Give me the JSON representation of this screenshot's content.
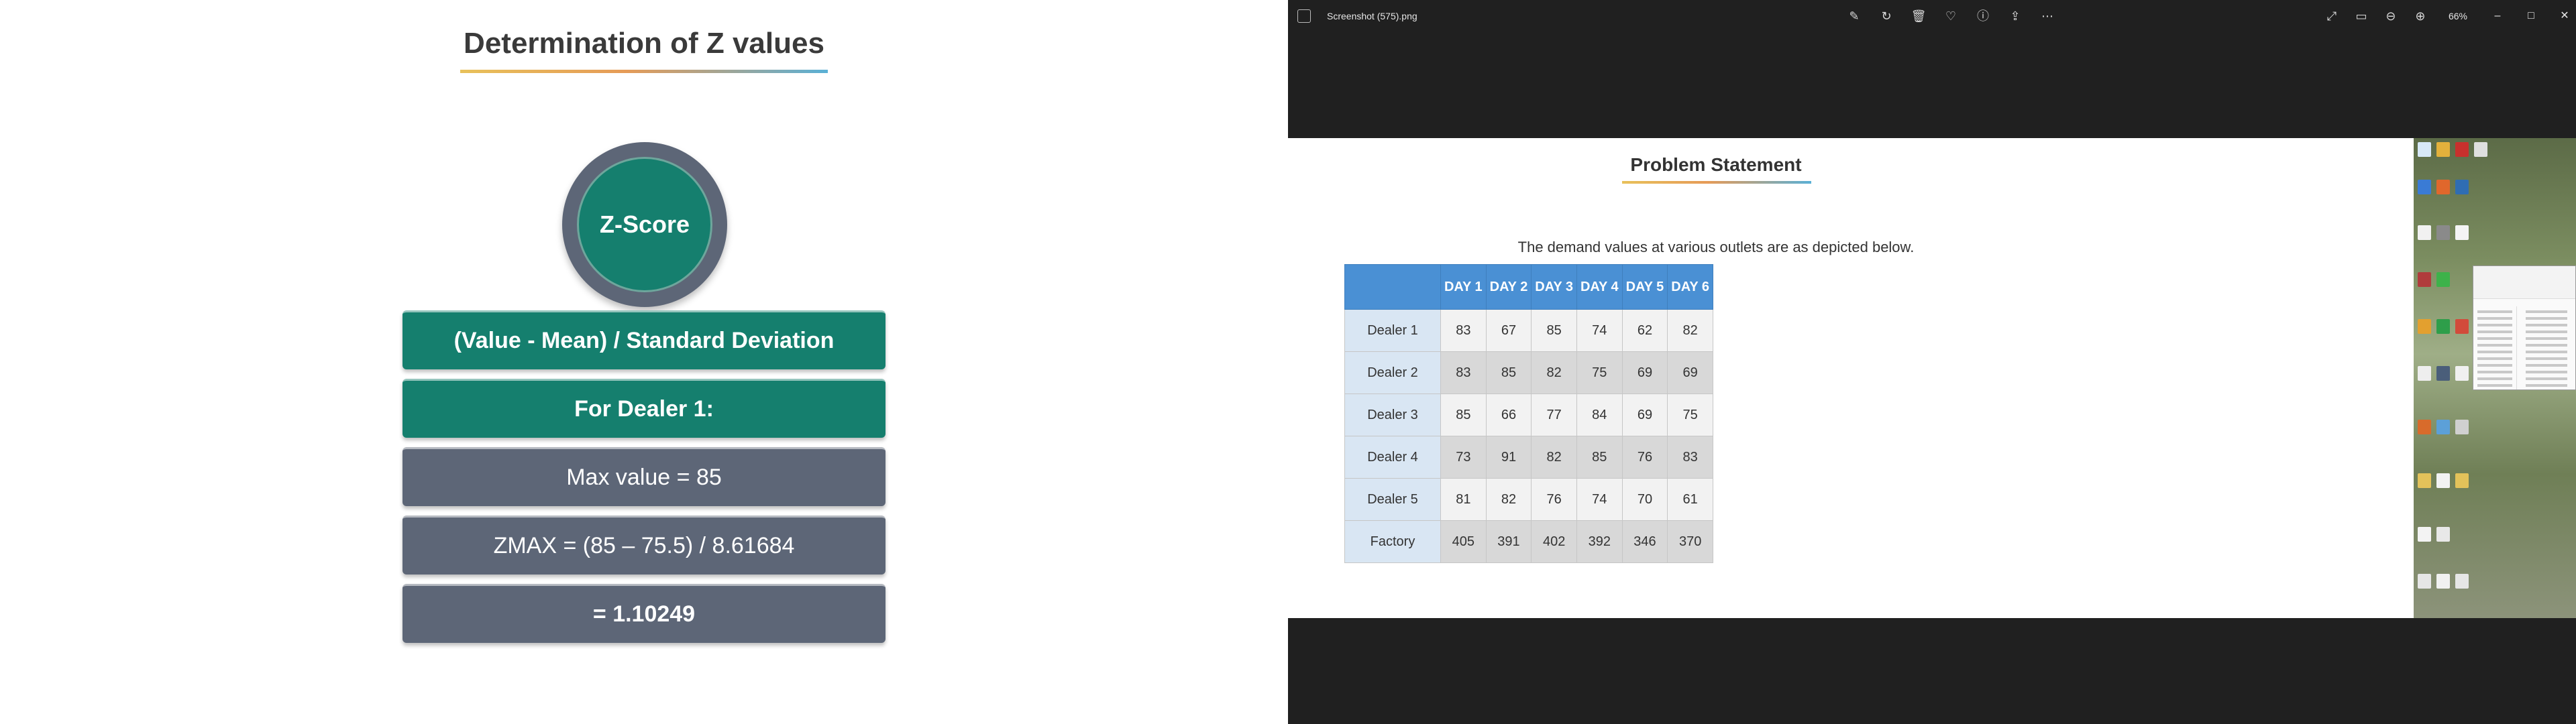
{
  "left_slide": {
    "title": "Determination of Z values",
    "circle_label": "Z-Score",
    "steps": [
      {
        "text": "(Value -  Mean) / Standard Deviation"
      },
      {
        "text": "For Dealer 1:"
      },
      {
        "text": "Max value =  85"
      },
      {
        "text": "ZMAX =  (85 – 75.5) / 8.61684"
      },
      {
        "text": "= 1.10249"
      }
    ],
    "colors": {
      "teal": "#157f6e",
      "slate": "#5d6677"
    }
  },
  "viewer": {
    "filename": "Screenshot (575).png",
    "zoom": "66%",
    "toolbar_icons": [
      "edit-icon",
      "rotate-icon",
      "delete-icon",
      "favorite-icon",
      "info-icon",
      "share-icon",
      "more-icon"
    ],
    "right_icons": [
      "fullscreen-icon",
      "fit-icon",
      "zoom-out-icon",
      "zoom-in-icon"
    ],
    "window_buttons": {
      "minimize": "–",
      "maximize": "□",
      "close": "✕"
    },
    "image": {
      "title": "Problem Statement",
      "subtitle": "The demand values at various outlets are as depicted below.",
      "table": {
        "columns": [
          "DAY 1",
          "DAY 2",
          "DAY 3",
          "DAY 4",
          "DAY 5",
          "DAY 6"
        ],
        "rows": [
          {
            "label": "Dealer 1",
            "values": [
              "83",
              "67",
              "85",
              "74",
              "62",
              "82"
            ]
          },
          {
            "label": "Dealer 2",
            "values": [
              "83",
              "85",
              "82",
              "75",
              "69",
              "69"
            ]
          },
          {
            "label": "Dealer 3",
            "values": [
              "85",
              "66",
              "77",
              "84",
              "69",
              "75"
            ]
          },
          {
            "label": "Dealer 4",
            "values": [
              "73",
              "91",
              "82",
              "85",
              "76",
              "83"
            ]
          },
          {
            "label": "Dealer 5",
            "values": [
              "81",
              "82",
              "76",
              "74",
              "70",
              "61"
            ]
          },
          {
            "label": "Factory",
            "values": [
              "405",
              "391",
              "402",
              "392",
              "346",
              "370"
            ]
          }
        ]
      }
    }
  }
}
